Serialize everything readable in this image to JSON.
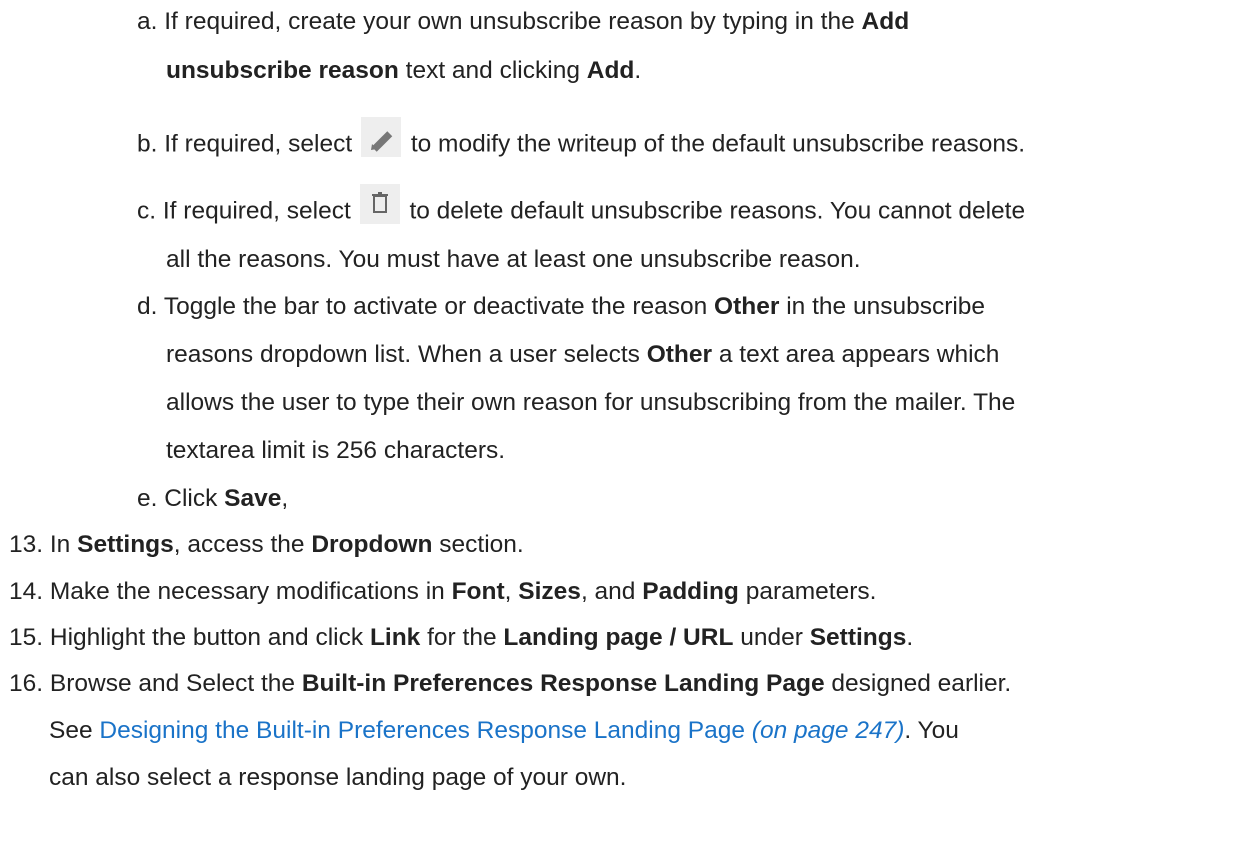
{
  "steps_sub": [
    {
      "marker": "a.",
      "line1": [
        "If required, create your own unsubscribe reason by typing in the ",
        "Add"
      ],
      "line2": [
        "unsubscribe reason",
        " text and clicking ",
        "Add",
        "."
      ]
    },
    {
      "marker": "b.",
      "before": "If required, select",
      "icon": "pencil-icon",
      "after": "to modify the writeup of the default unsubscribe reasons."
    },
    {
      "marker": "c.",
      "before": "If required, select",
      "icon": "trash-icon",
      "after": "to delete default unsubscribe reasons. You cannot delete",
      "line2": "all the reasons. You must have at least one unsubscribe reason."
    },
    {
      "marker": "d.",
      "line1": [
        "Toggle the bar to activate or deactivate the reason ",
        "Other",
        " in the unsubscribe"
      ],
      "line2": [
        "reasons dropdown list. When a user selects ",
        "Other",
        " a text area appears which"
      ],
      "line3": "allows the user to type their own reason for unsubscribing from the mailer. The",
      "line4": "textarea limit is 256 characters."
    },
    {
      "marker": "e.",
      "line1": [
        "Click ",
        "Save",
        ","
      ]
    }
  ],
  "steps_main": [
    {
      "marker": "13.",
      "parts": [
        "In ",
        "Settings",
        ", access the ",
        "Dropdown",
        " section."
      ]
    },
    {
      "marker": "14.",
      "parts": [
        "Make the necessary modifications in ",
        "Font",
        ", ",
        "Sizes",
        ", and ",
        "Padding",
        " parameters."
      ]
    },
    {
      "marker": "15.",
      "parts": [
        "Highlight the button and click ",
        "Link",
        " for the ",
        "Landing page / URL",
        " under ",
        "Settings",
        "."
      ]
    },
    {
      "marker": "16.",
      "line1": [
        "Browse and Select the ",
        "Built-in Preferences Response Landing Page",
        " designed earlier."
      ],
      "line2": {
        "prefix": "See ",
        "link_text": "Designing the Built-in Preferences Response Landing Page",
        "page_ref": "(on page 247)",
        "suffix": ". You"
      },
      "line3": "can also select a response landing page of your own."
    }
  ]
}
